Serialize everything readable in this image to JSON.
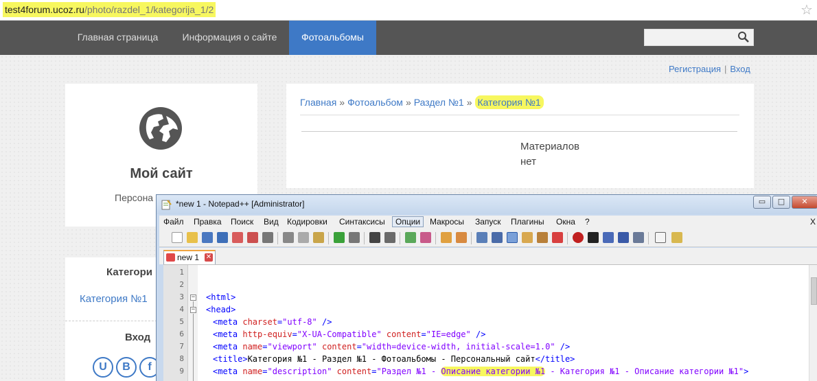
{
  "browser": {
    "url_host": "test4forum.ucoz.ru",
    "url_path": "/photo/razdel_1/kategorija_1/2",
    "star_icon": "star-icon"
  },
  "site_nav": {
    "items": [
      {
        "label": "Главная страница"
      },
      {
        "label": "Информация о сайте"
      },
      {
        "label": "Фотоальбомы"
      }
    ],
    "search_placeholder": "",
    "accent": "#3e79c6"
  },
  "auth": {
    "register": "Регистрация",
    "separator": "|",
    "login": "Вход"
  },
  "site_card": {
    "title": "Мой сайт",
    "subtitle": "Персона"
  },
  "main": {
    "breadcrumb": {
      "home": "Главная",
      "album": "Фотоальбом",
      "section": "Раздел №1",
      "current": "Категория №1",
      "sep": "»"
    },
    "empty_line1": "Материалов",
    "empty_line2": "нет"
  },
  "categories": {
    "title": "Категори",
    "link": "Категория №1",
    "login_title": "Вход",
    "social": [
      "U",
      "B",
      "f"
    ]
  },
  "notepad": {
    "title": "*new  1 - Notepad++ [Administrator]",
    "window_buttons": [
      "▭",
      "□",
      "✕"
    ],
    "menu": [
      "Файл",
      "Правка",
      "Поиск",
      "Вид",
      "Кодировки",
      "Синтаксисы",
      "Опции",
      "Макросы",
      "Запуск",
      "Плагины",
      "Окна",
      "?",
      "X"
    ],
    "tab_label": "new  1",
    "tab_close": "✕",
    "line_numbers": [
      "1",
      "2",
      "3",
      "4",
      "5",
      "6",
      "7",
      "8",
      "9"
    ],
    "code": {
      "l3_tag": "<html>",
      "l4_tag": "<head>",
      "l5_tag": "<meta",
      "l5_attr": "charset",
      "l5_val": "\"utf-8\"",
      "l5_end": "/>",
      "l6_tag": "<meta",
      "l6_attr1": "http-equiv",
      "l6_val1": "\"X-UA-Compatible\"",
      "l6_attr2": "content",
      "l6_val2": "\"IE=edge\"",
      "l6_end": "/>",
      "l7_tag": "<meta",
      "l7_attr1": "name",
      "l7_val1": "\"viewport\"",
      "l7_attr2": "content",
      "l7_val2": "\"width=device-width, initial-scale=1.0\"",
      "l7_end": "/>",
      "l8_open": "<title>",
      "l8_text": "Категория №1 - Раздел №1 - Фотоальбомы - Персональный сайт",
      "l8_close": "</title>",
      "l9_tag": "<meta",
      "l9_attr1": "name",
      "l9_val1": "\"description\"",
      "l9_attr2": "content",
      "l9_val2a": "\"Раздел №1 - ",
      "l9_val2b": "Описание категории №1",
      "l9_val2c": " - Категория №1 - Описание категории №1\"",
      "l9_end": ">"
    }
  }
}
